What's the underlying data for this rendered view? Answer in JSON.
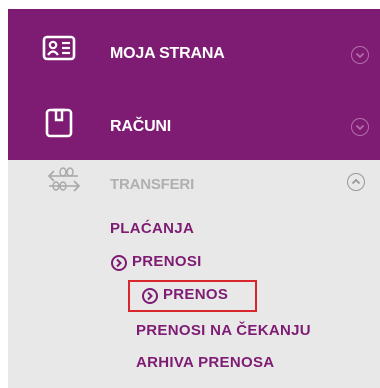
{
  "menu": {
    "items": [
      {
        "label": "MOJA STRANA",
        "icon": "profile-card-icon"
      },
      {
        "label": "RAČUNI",
        "icon": "account-card-icon"
      },
      {
        "label": "TRANSFERI",
        "icon": "transfer-arrows-icon"
      }
    ],
    "submenu": {
      "placanja": "PLAĆANJA",
      "prenosi": "PRENOSI",
      "prenos": "PRENOS",
      "prenosi_na_cekanju": "PRENOSI NA ČEKANJU",
      "arhiva_prenosa": "ARHIVA PRENOSA"
    }
  },
  "colors": {
    "brand": "#7e1c73",
    "highlight": "#d9262c",
    "gray": "#e8e8e8"
  }
}
